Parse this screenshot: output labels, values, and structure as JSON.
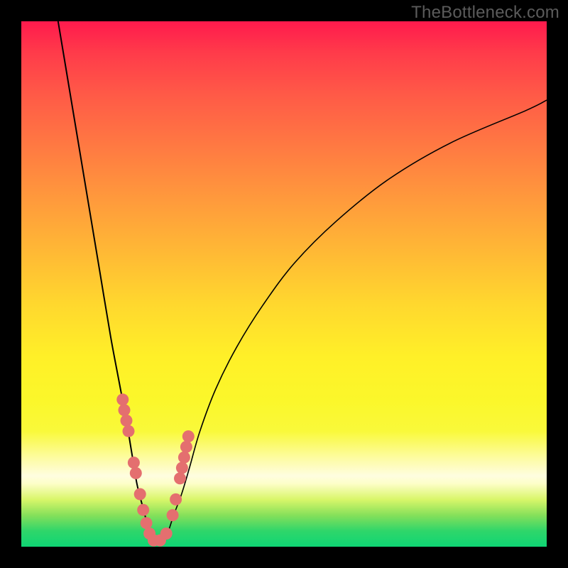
{
  "watermark": "TheBottleneck.com",
  "chart_data": {
    "type": "line",
    "title": "",
    "xlabel": "",
    "ylabel": "",
    "xlim": [
      0,
      100
    ],
    "ylim": [
      0,
      100
    ],
    "grid": false,
    "legend_position": "none",
    "series": [
      {
        "name": "left-curve",
        "x": [
          7,
          9,
          11,
          13,
          15,
          17,
          18.5,
          20,
          21,
          22,
          23,
          23.8,
          24.4,
          25
        ],
        "y": [
          100,
          88,
          76,
          64,
          52,
          40,
          32,
          24,
          18,
          12,
          8,
          5,
          3,
          1
        ]
      },
      {
        "name": "right-curve",
        "x": [
          27,
          28,
          29,
          30.5,
          32,
          34,
          37,
          41,
          46,
          52,
          60,
          70,
          82,
          96,
          100
        ],
        "y": [
          1,
          3,
          6,
          10,
          15,
          22,
          30,
          38,
          46,
          54,
          62,
          70,
          77,
          83,
          85
        ]
      }
    ],
    "highlight_points": {
      "name": "marked-dots",
      "color": "#e46f6f",
      "points": [
        {
          "x": 19.3,
          "y": 28
        },
        {
          "x": 19.6,
          "y": 26
        },
        {
          "x": 20.0,
          "y": 24
        },
        {
          "x": 20.4,
          "y": 22
        },
        {
          "x": 21.4,
          "y": 16
        },
        {
          "x": 21.8,
          "y": 14
        },
        {
          "x": 22.6,
          "y": 10
        },
        {
          "x": 23.2,
          "y": 7
        },
        {
          "x": 23.8,
          "y": 4.5
        },
        {
          "x": 24.4,
          "y": 2.5
        },
        {
          "x": 25.2,
          "y": 1.2
        },
        {
          "x": 26.4,
          "y": 1.2
        },
        {
          "x": 27.6,
          "y": 2.5
        },
        {
          "x": 28.8,
          "y": 6
        },
        {
          "x": 29.4,
          "y": 9
        },
        {
          "x": 30.2,
          "y": 13
        },
        {
          "x": 30.6,
          "y": 15
        },
        {
          "x": 31.0,
          "y": 17
        },
        {
          "x": 31.4,
          "y": 19
        },
        {
          "x": 31.8,
          "y": 21
        }
      ]
    },
    "background_gradient": {
      "top": "#ff1a4d",
      "mid": "#fff028",
      "bottom": "#0fd574"
    }
  }
}
